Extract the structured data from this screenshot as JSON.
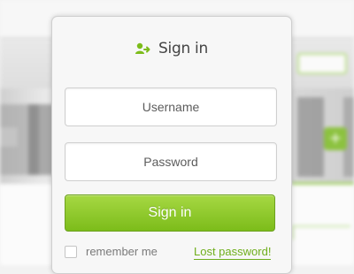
{
  "login": {
    "title": "Sign in",
    "title_icon": "user-add-icon",
    "username_placeholder": "Username",
    "password_placeholder": "Password",
    "submit_label": "Sign in",
    "remember_label": "remember me",
    "lost_password_label": "Lost password!"
  },
  "background": {
    "add_button_glyph": "+"
  },
  "colors": {
    "accent": "#7cbc1a",
    "accent_light": "#a6d843",
    "link": "#6fae1c"
  }
}
